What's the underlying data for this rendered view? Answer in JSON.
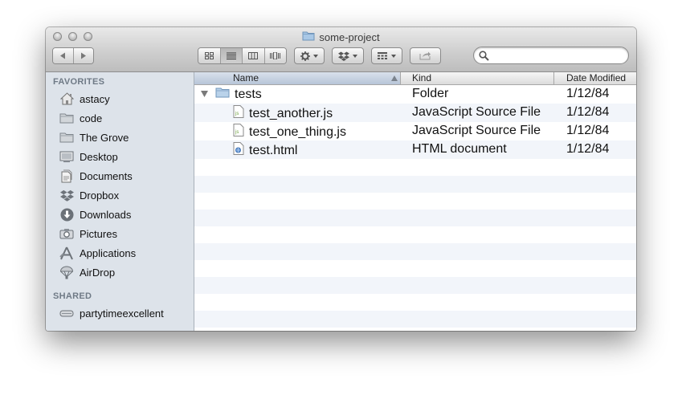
{
  "window": {
    "title": "some-project"
  },
  "toolbar": {
    "view_modes": [
      "icon-view",
      "list-view",
      "column-view",
      "coverflow-view"
    ],
    "active_view": "list-view",
    "action_icon": "gear-icon",
    "dropbox_icon": "dropbox-icon",
    "arrange_icon": "arrange-icon",
    "share_icon": "share-icon",
    "search": {
      "value": "",
      "placeholder": ""
    }
  },
  "sidebar": {
    "favorites_header": "FAVORITES",
    "items": [
      {
        "label": "astacy",
        "icon": "home-icon"
      },
      {
        "label": "code",
        "icon": "folder-icon"
      },
      {
        "label": "The Grove",
        "icon": "folder-icon"
      },
      {
        "label": "Desktop",
        "icon": "desktop-icon"
      },
      {
        "label": "Documents",
        "icon": "documents-icon"
      },
      {
        "label": "Dropbox",
        "icon": "dropbox-icon"
      },
      {
        "label": "Downloads",
        "icon": "downloads-icon"
      },
      {
        "label": "Pictures",
        "icon": "camera-icon"
      },
      {
        "label": "Applications",
        "icon": "applications-icon"
      },
      {
        "label": "AirDrop",
        "icon": "airdrop-icon"
      }
    ],
    "shared_header": "SHARED",
    "shared_items": [
      {
        "label": "partytimeexcellent",
        "icon": "server-icon"
      }
    ]
  },
  "list": {
    "columns": {
      "name": "Name",
      "kind": "Kind",
      "date": "Date Modified"
    },
    "rows": [
      {
        "name": "tests",
        "kind": "Folder",
        "date": "1/12/84",
        "icon": "folder-icon",
        "expanded": true
      },
      {
        "name": "test_another.js",
        "kind": "JavaScript Source File",
        "date": "1/12/84",
        "icon": "js-file-icon"
      },
      {
        "name": "test_one_thing.js",
        "kind": "JavaScript Source File",
        "date": "1/12/84",
        "icon": "js-file-icon"
      },
      {
        "name": "test.html",
        "kind": "HTML document",
        "date": "1/12/84",
        "icon": "html-file-icon"
      }
    ]
  }
}
